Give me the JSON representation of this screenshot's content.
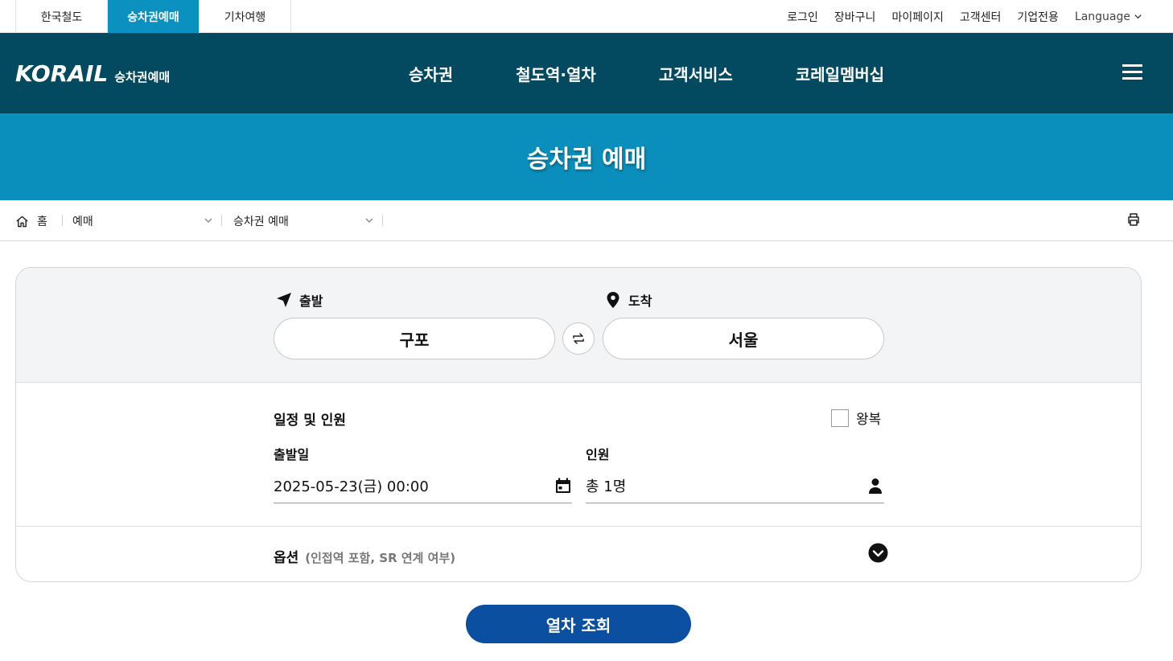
{
  "topbar": {
    "site_tabs": [
      {
        "label": "한국철도"
      },
      {
        "label": "승차권예매"
      },
      {
        "label": "기차여행"
      }
    ],
    "links": [
      {
        "label": "로그인"
      },
      {
        "label": "장바구니"
      },
      {
        "label": "마이페이지"
      },
      {
        "label": "고객센터"
      },
      {
        "label": "기업전용"
      }
    ],
    "language_label": "Language"
  },
  "header": {
    "logo_text": "KORAIL",
    "logo_sub": "승차권예매",
    "nav": [
      {
        "label": "승차권"
      },
      {
        "label": "철도역·열차"
      },
      {
        "label": "고객서비스"
      },
      {
        "label": "코레일멤버십"
      }
    ],
    "menu_icon": "hamburger-icon"
  },
  "page_title": "승차권 예매",
  "breadcrumb": {
    "home_label": "홈",
    "level1": "예매",
    "level2": "승차권 예매"
  },
  "booking": {
    "departure_label": "출발",
    "arrival_label": "도착",
    "departure_station": "구포",
    "arrival_station": "서울",
    "schedule_title": "일정 및 인원",
    "roundtrip_label": "왕복",
    "roundtrip_checked": false,
    "date_label": "출발일",
    "date_value": "2025-05-23(금) 00:00",
    "passengers_label": "인원",
    "passengers_value": "총 1명",
    "option_title": "옵션",
    "option_desc": "(인접역 포함, SR 연계 여부)",
    "search_button": "열차 조회"
  },
  "colors": {
    "header_bg": "#03495f",
    "accent": "#0a91c0",
    "title_band": "#0a8fbc",
    "search_button": "#0a4fa0"
  }
}
